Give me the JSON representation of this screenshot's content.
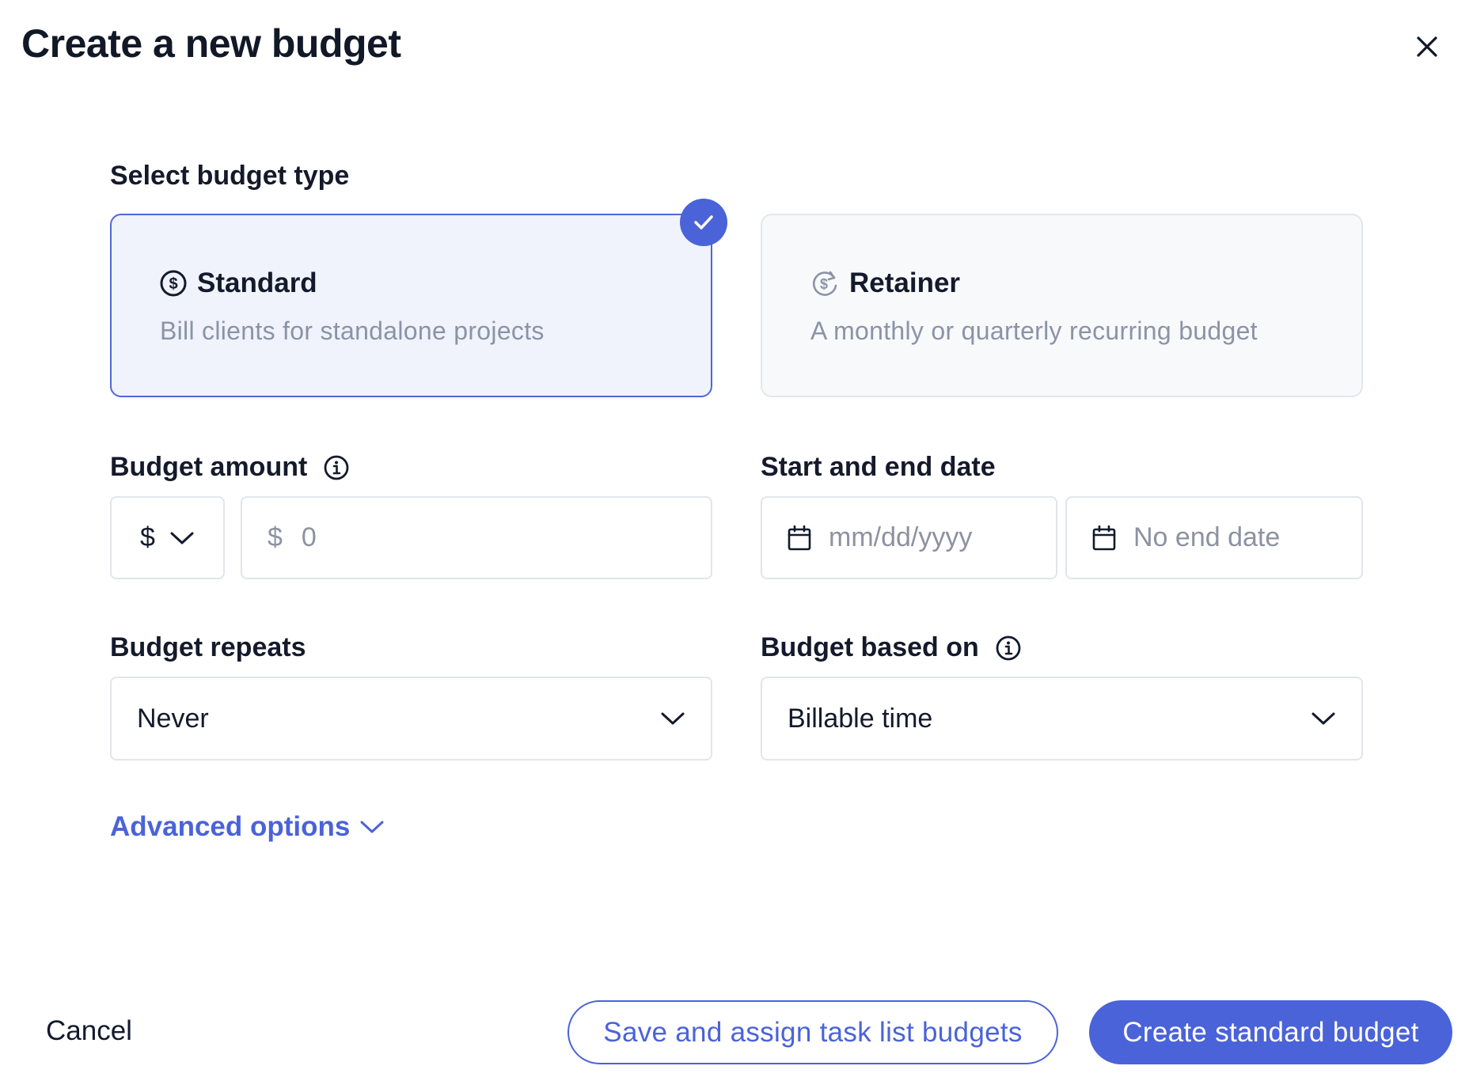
{
  "dialog": {
    "title": "Create a new budget"
  },
  "budget_type": {
    "label": "Select budget type",
    "options": [
      {
        "title": "Standard",
        "description": "Bill clients for standalone projects",
        "selected": true
      },
      {
        "title": "Retainer",
        "description": "A monthly or quarterly recurring budget",
        "selected": false
      }
    ]
  },
  "budget_amount": {
    "label": "Budget amount",
    "currency": "$",
    "amount_prefix": "$",
    "amount_placeholder": "0"
  },
  "dates": {
    "label": "Start and end date",
    "start_placeholder": "mm/dd/yyyy",
    "end_placeholder": "No end date"
  },
  "repeats": {
    "label": "Budget repeats",
    "value": "Never"
  },
  "based_on": {
    "label": "Budget based on",
    "value": "Billable time"
  },
  "advanced_options": {
    "label": "Advanced options"
  },
  "footer": {
    "cancel": "Cancel",
    "save_assign": "Save and assign task list budgets",
    "create": "Create standard budget"
  },
  "colors": {
    "accent": "#4a63d9",
    "selected_card_bg": "#f0f3fc",
    "muted_text": "#8b93a6"
  }
}
